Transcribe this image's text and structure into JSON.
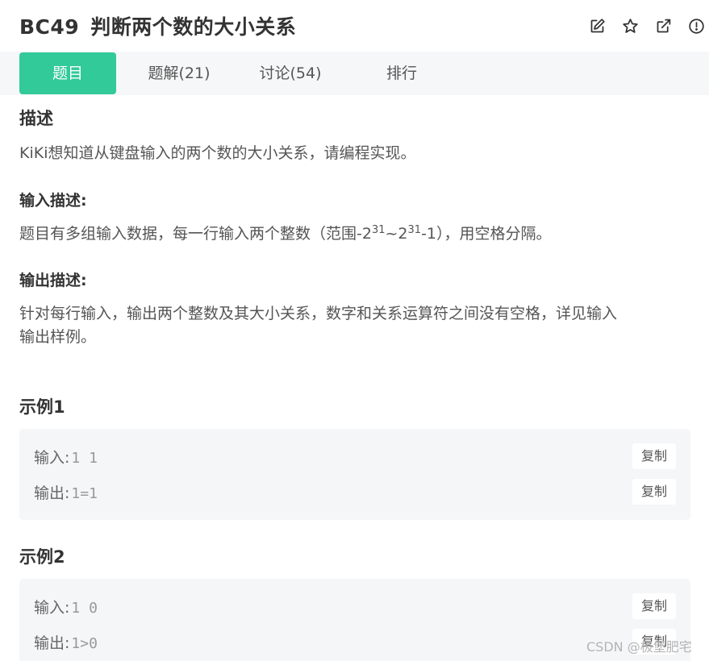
{
  "problem": {
    "code": "BC49",
    "name": "判断两个数的大小关系"
  },
  "header_icons": [
    "edit-icon",
    "star-icon",
    "external-link-icon",
    "report-icon"
  ],
  "tabs": [
    {
      "label": "题目",
      "active": true
    },
    {
      "label": "题解(21)",
      "active": false
    },
    {
      "label": "讨论(54)",
      "active": false
    },
    {
      "label": "排行",
      "active": false
    }
  ],
  "description": {
    "heading": "描述",
    "text": "KiKi想知道从键盘输入的两个数的大小关系，请编程实现。"
  },
  "input_desc": {
    "heading": "输入描述:",
    "text_before": "题目有多组输入数据，每一行输入两个整数（范围-2",
    "sup1": "31",
    "text_mid": "~2",
    "sup2": "31",
    "text_after": "-1），用空格分隔。"
  },
  "output_desc": {
    "heading": "输出描述:",
    "line1": "针对每行输入，输出两个整数及其大小关系，数字和关系运算符之间没有空格，详见输入",
    "line2": "输出样例。"
  },
  "examples": [
    {
      "title": "示例1",
      "input_label": "输入:",
      "input_value": "1 1",
      "output_label": "输出:",
      "output_value": "1=1",
      "copy_label": "复制"
    },
    {
      "title": "示例2",
      "input_label": "输入:",
      "input_value": "1 0",
      "output_label": "输出:",
      "output_value": "1>0",
      "copy_label": "复制"
    }
  ],
  "watermark": "CSDN @极堡肥宅",
  "colors": {
    "accent": "#32ca99",
    "tab_bar": "#f6f7f8",
    "example_bg": "#f5f6f8"
  }
}
